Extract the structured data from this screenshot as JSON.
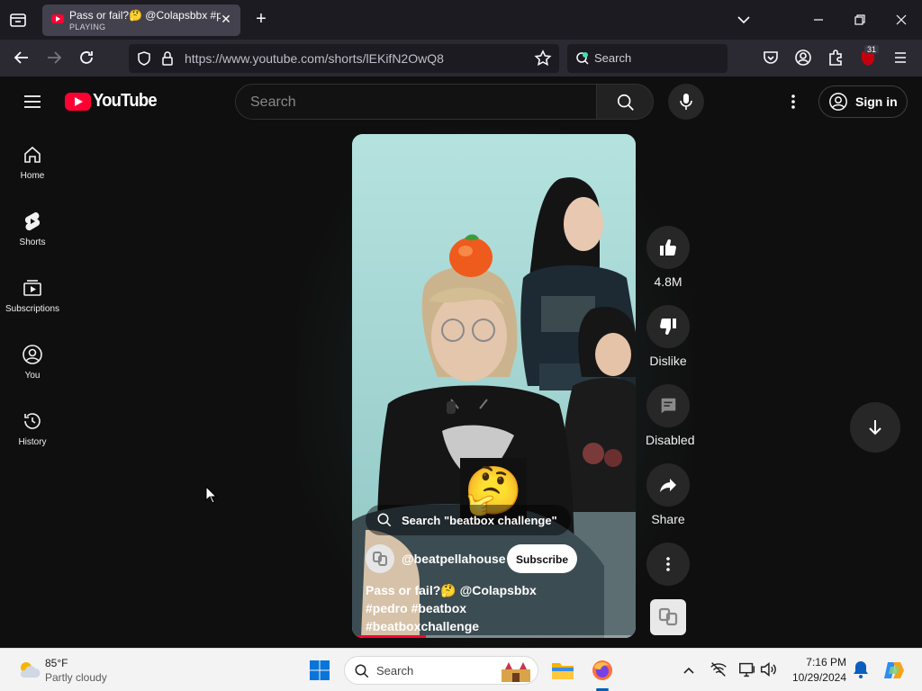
{
  "browser": {
    "tab": {
      "title": "Pass or fail?🤔 @Colapsbbx #p",
      "status": "PLAYING"
    },
    "url": "https://www.youtube.com/shorts/lEKifN2OwQ8",
    "search_placeholder": "Search",
    "extension_badge": "31"
  },
  "youtube": {
    "logo_text": "YouTube",
    "search_placeholder": "Search",
    "sign_in_label": "Sign in",
    "guide": [
      {
        "label": "Home",
        "icon": "home-icon"
      },
      {
        "label": "Shorts",
        "icon": "shorts-icon"
      },
      {
        "label": "Subscriptions",
        "icon": "subscriptions-icon"
      },
      {
        "label": "You",
        "icon": "you-icon"
      },
      {
        "label": "History",
        "icon": "history-icon"
      }
    ],
    "short": {
      "search_chip": "Search \"beatbox challenge\"",
      "channel": "@beatpellahouse",
      "subscribe_label": "Subscribe",
      "caption": "Pass or fail?🤔 @Colapsbbx #pedro #beatbox #beatboxchallenge",
      "overlay_emoji": "🤔",
      "progress": 0.26,
      "actions": {
        "like": "4.8M",
        "dislike": "Dislike",
        "comments": "Disabled",
        "share": "Share"
      }
    }
  },
  "taskbar": {
    "weather_temp": "85°F",
    "weather_desc": "Partly cloudy",
    "search_placeholder": "Search",
    "time": "7:16 PM",
    "date": "10/29/2024"
  },
  "colors": {
    "accent": "#ff0033",
    "background": "#0f0f0f",
    "browser_chrome": "#2b2a33"
  }
}
